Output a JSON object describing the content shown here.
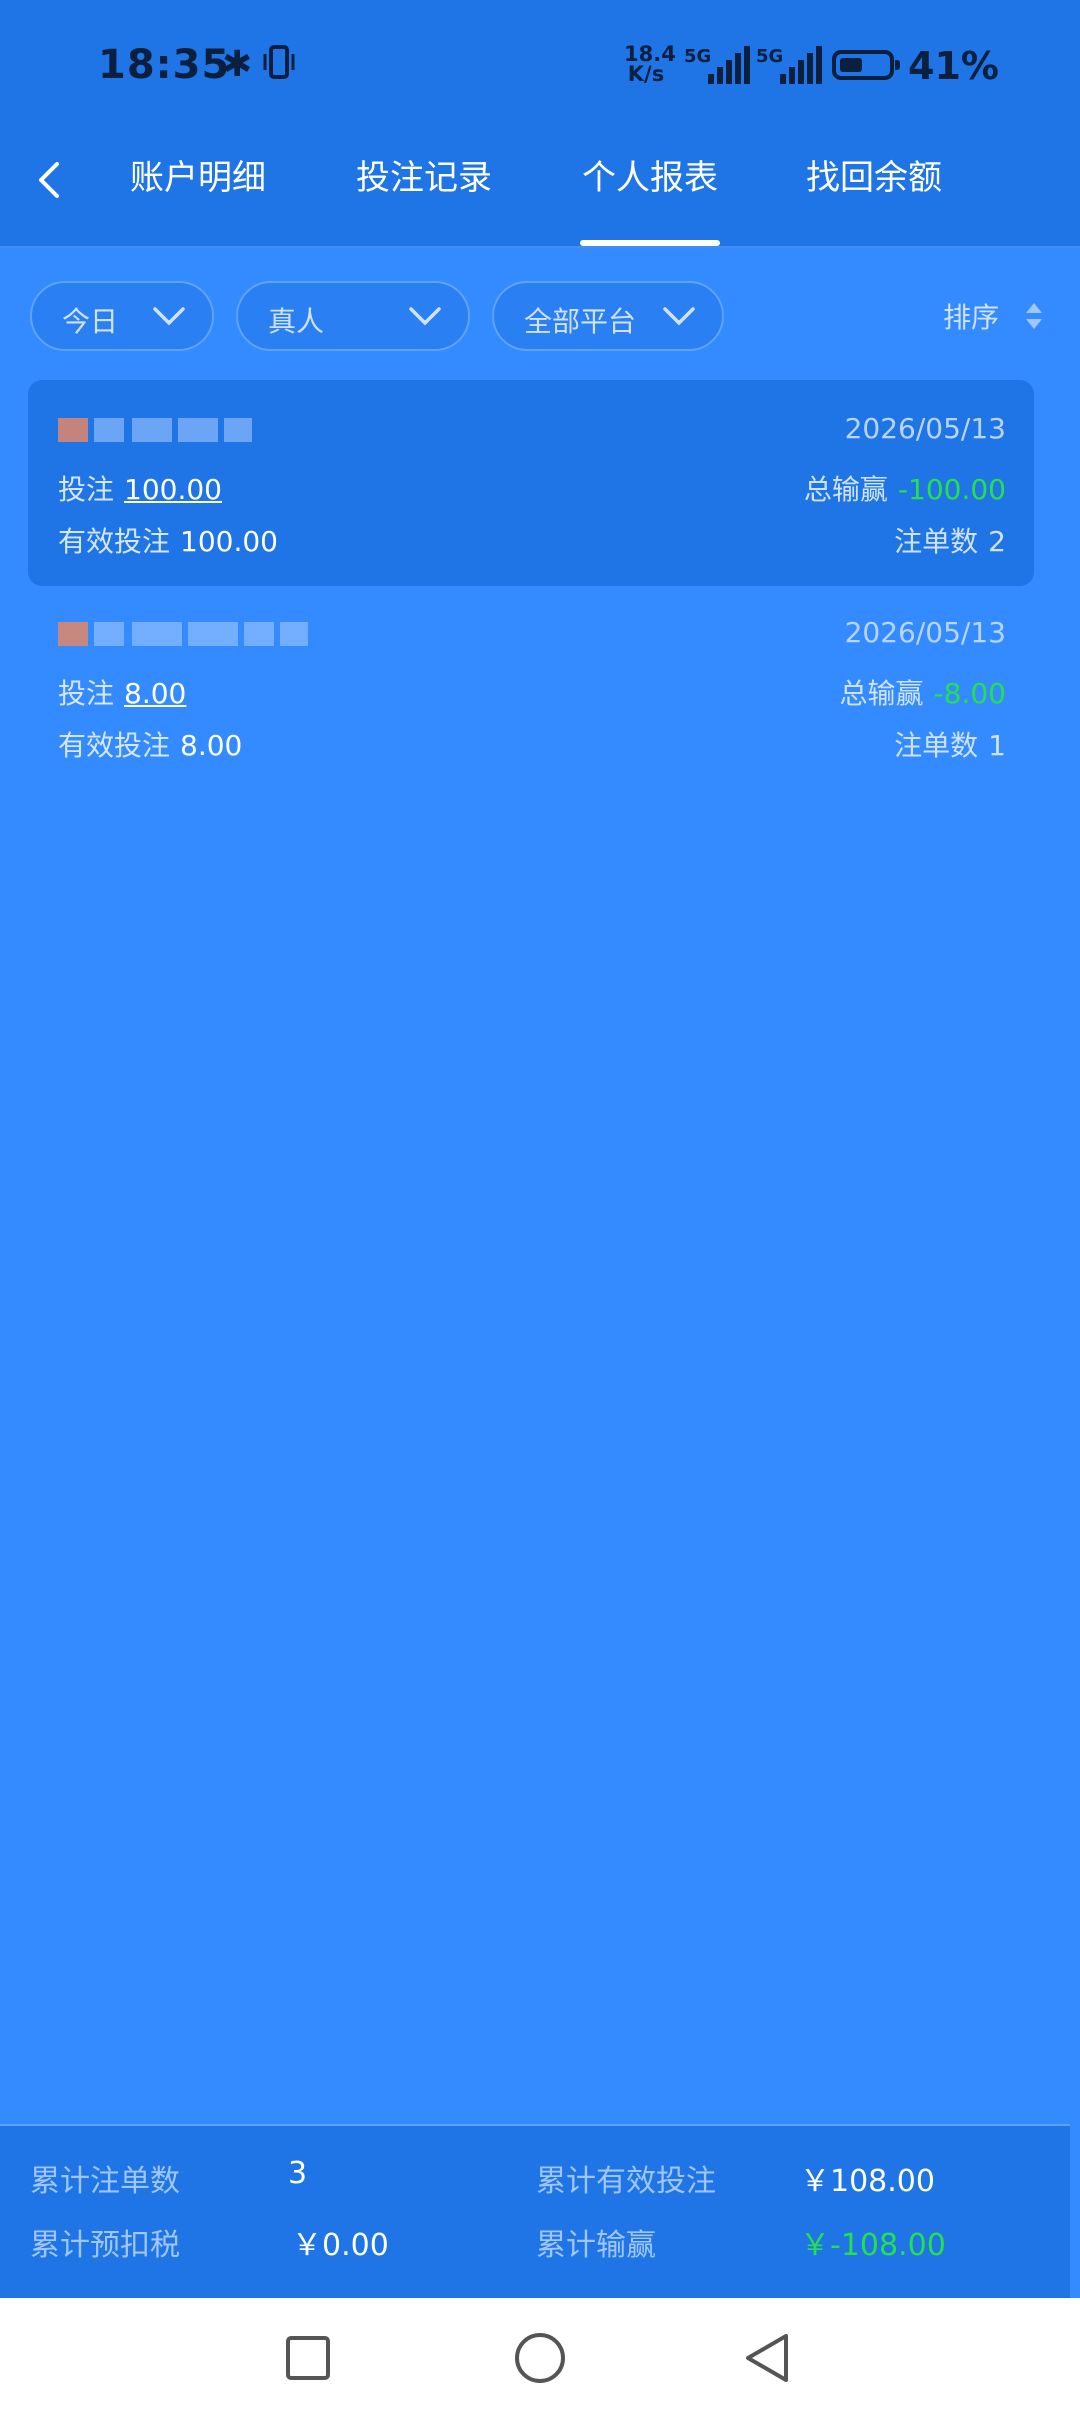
{
  "status_bar": {
    "time": "18:35",
    "net_speed_top": "18.4",
    "net_speed_bottom": "K/s",
    "sim1_tag": "5G",
    "sim2_tag": "5G",
    "battery": "41%"
  },
  "header": {
    "tabs": [
      {
        "label": "账户明细"
      },
      {
        "label": "投注记录"
      },
      {
        "label": "个人报表"
      },
      {
        "label": "找回余额"
      }
    ],
    "active_tab": "个人报表"
  },
  "filters": {
    "period": "今日",
    "category": "真人",
    "platform": "全部平台",
    "sort_label": "排序"
  },
  "records": [
    {
      "date": "2026/05/13",
      "bet_label": "投注",
      "bet": "100.00",
      "win_label": "总输赢",
      "win": "-100.00",
      "valid_label": "有效投注",
      "valid": "100.00",
      "count_label": "注单数",
      "count": "2"
    },
    {
      "date": "2026/05/13",
      "bet_label": "投注",
      "bet": "8.00",
      "win_label": "总输赢",
      "win": "-8.00",
      "valid_label": "有效投注",
      "valid": "8.00",
      "count_label": "注单数",
      "count": "1"
    }
  ],
  "summary": {
    "total_orders_label": "累计注单数",
    "total_orders": "3",
    "total_valid_label": "累计有效投注",
    "total_valid": "￥108.00",
    "total_tax_label": "累计预扣税",
    "total_tax": "￥0.00",
    "total_win_label": "累计输赢",
    "total_win": "￥-108.00"
  },
  "colors": {
    "page_bg": "#338bff",
    "header_bg": "#1f74e6",
    "negative": "#25e04d"
  }
}
